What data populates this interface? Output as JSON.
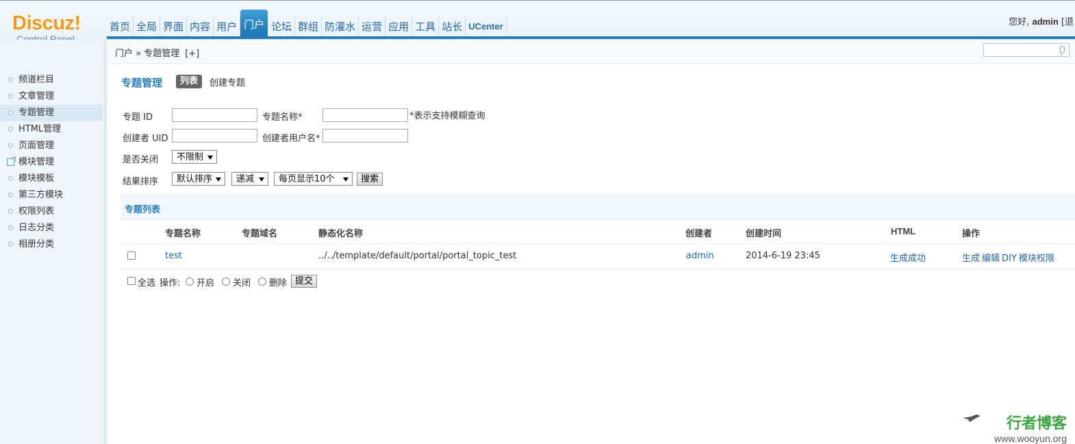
{
  "header": {
    "logo_main": "Discuz!",
    "logo_sub": "Control Panel",
    "nav": [
      "首页",
      "全局",
      "界面",
      "内容",
      "用户",
      "门户",
      "论坛",
      "群组",
      "防灌水",
      "运营",
      "应用",
      "工具",
      "站长",
      "UCenter"
    ],
    "active_nav": "门户",
    "greeting_prefix": "您好,",
    "username": "admin",
    "greeting_suffix": "[退"
  },
  "breadcrumb": {
    "text": "门户 » 专题管理",
    "add": "[+]"
  },
  "sidebar": {
    "items": [
      {
        "label": "频道栏目"
      },
      {
        "label": "文章管理"
      },
      {
        "label": "专题管理"
      },
      {
        "label": "HTML管理"
      },
      {
        "label": "页面管理"
      },
      {
        "label": "模块管理"
      },
      {
        "label": "模块模板"
      },
      {
        "label": "第三方模块"
      },
      {
        "label": "权限列表"
      },
      {
        "label": "日志分类"
      },
      {
        "label": "相册分类"
      }
    ],
    "active": "专题管理"
  },
  "main": {
    "title": "专题管理",
    "tab_list": "列表",
    "tab_create": "创建专题",
    "filters": {
      "topic_id_label": "专题 ID",
      "topic_name_label": "专题名称*",
      "fuzzy_hint": "*表示支持模糊查询",
      "creator_uid_label": "创建者 UID",
      "creator_name_label": "创建者用户名*",
      "closed_label": "是否关闭",
      "closed_value": "不限制",
      "sort_label": "结果排序",
      "sort_value": "默认排序",
      "order_value": "递减",
      "perpage_value": "每页显示10个",
      "search_button": "搜索"
    },
    "list_title": "专题列表",
    "columns": [
      "专题名称",
      "专题域名",
      "静态化名称",
      "创建者",
      "创建时间",
      "HTML",
      "操作"
    ],
    "rows": [
      {
        "name": "test",
        "domain": "",
        "static_name": "../../template/default/portal/portal_topic_test",
        "creator": "admin",
        "created": "2014-6-19 23:45",
        "html": "生成成功",
        "ops": [
          "生成",
          "编辑",
          "DIY",
          "模块权限"
        ]
      }
    ],
    "footer": {
      "select_all": "全选",
      "op_label": "操作:",
      "op_open": "开启",
      "op_close": "关闭",
      "op_delete": "删除",
      "submit": "提交"
    }
  },
  "watermark": {
    "title": "行者博客",
    "url": "www.wooyun.org"
  }
}
